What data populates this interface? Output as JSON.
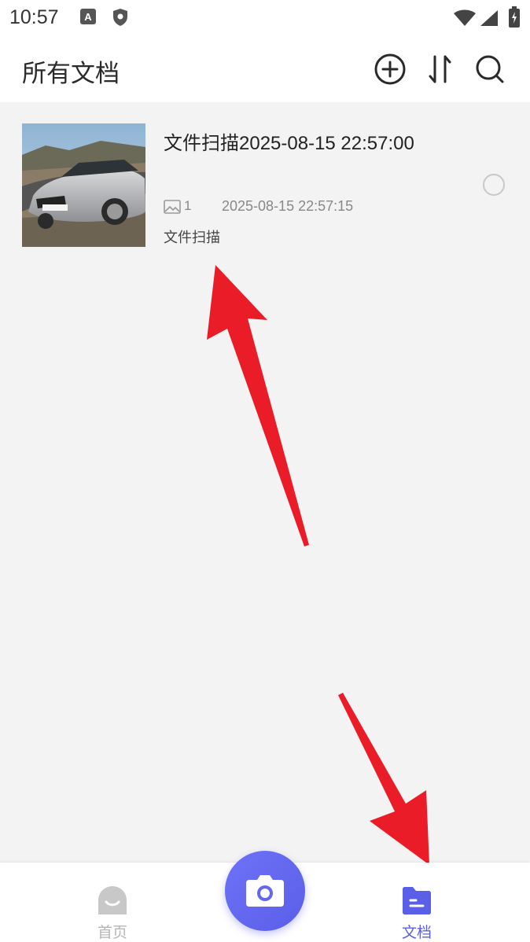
{
  "status_bar": {
    "time": "10:57"
  },
  "header": {
    "title": "所有文档"
  },
  "documents": [
    {
      "title": "文件扫描2025-08-15 22:57:00",
      "page_count": "1",
      "date": "2025-08-15 22:57:15",
      "tag": "文件扫描"
    }
  ],
  "bottom_nav": {
    "home_label": "首页",
    "docs_label": "文档",
    "active_color": "#5b5fe8",
    "inactive_color": "#b5b5b5"
  }
}
